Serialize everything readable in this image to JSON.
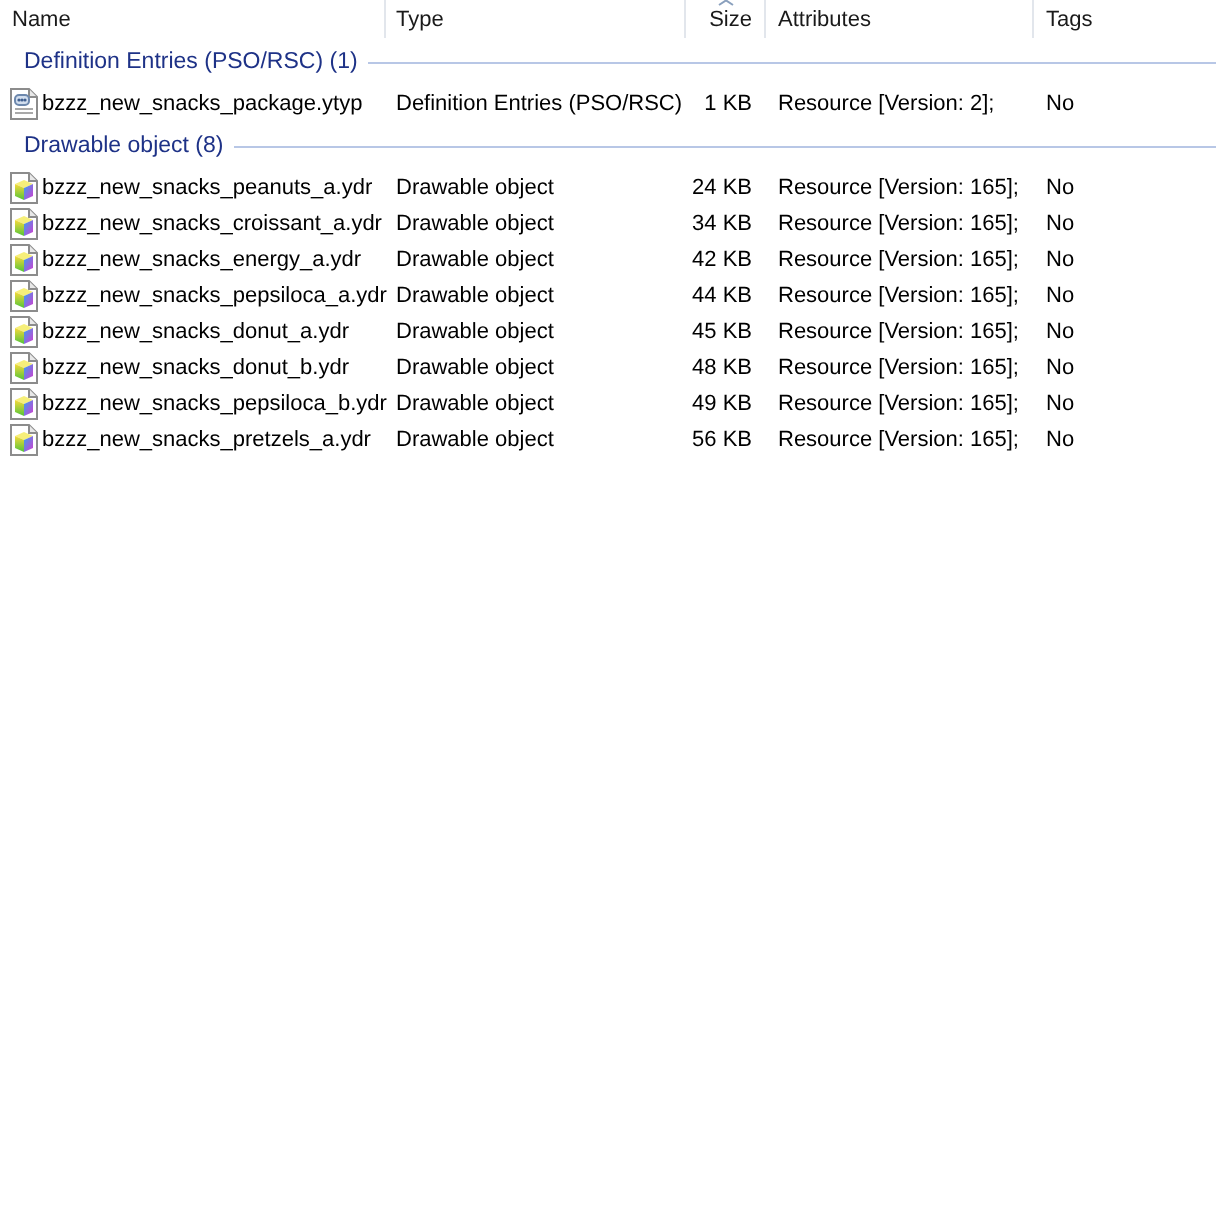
{
  "columns": [
    {
      "label": "Name",
      "sorted": false
    },
    {
      "label": "Type",
      "sorted": false
    },
    {
      "label": "Size",
      "sorted": true
    },
    {
      "label": "Attributes",
      "sorted": false
    },
    {
      "label": "Tags",
      "sorted": false
    }
  ],
  "groups": [
    {
      "title": "Definition Entries (PSO/RSC) (1)",
      "files": [
        {
          "kind": "definition",
          "name": "bzzz_new_snacks_package.ytyp",
          "type": "Definition Entries (PSO/RSC)",
          "size": "1 KB",
          "attributes": "Resource [Version: 2];",
          "tags": "No"
        }
      ]
    },
    {
      "title": "Drawable object (8)",
      "files": [
        {
          "kind": "drawable",
          "name": "bzzz_new_snacks_peanuts_a.ydr",
          "type": "Drawable object",
          "size": "24 KB",
          "attributes": "Resource [Version: 165];",
          "tags": "No"
        },
        {
          "kind": "drawable",
          "name": "bzzz_new_snacks_croissant_a.ydr",
          "type": "Drawable object",
          "size": "34 KB",
          "attributes": "Resource [Version: 165];",
          "tags": "No"
        },
        {
          "kind": "drawable",
          "name": "bzzz_new_snacks_energy_a.ydr",
          "type": "Drawable object",
          "size": "42 KB",
          "attributes": "Resource [Version: 165];",
          "tags": "No"
        },
        {
          "kind": "drawable",
          "name": "bzzz_new_snacks_pepsiloca_a.ydr",
          "type": "Drawable object",
          "size": "44 KB",
          "attributes": "Resource [Version: 165];",
          "tags": "No"
        },
        {
          "kind": "drawable",
          "name": "bzzz_new_snacks_donut_a.ydr",
          "type": "Drawable object",
          "size": "45 KB",
          "attributes": "Resource [Version: 165];",
          "tags": "No"
        },
        {
          "kind": "drawable",
          "name": "bzzz_new_snacks_donut_b.ydr",
          "type": "Drawable object",
          "size": "48 KB",
          "attributes": "Resource [Version: 165];",
          "tags": "No"
        },
        {
          "kind": "drawable",
          "name": "bzzz_new_snacks_pepsiloca_b.ydr",
          "type": "Drawable object",
          "size": "49 KB",
          "attributes": "Resource [Version: 165];",
          "tags": "No"
        },
        {
          "kind": "drawable",
          "name": "bzzz_new_snacks_pretzels_a.ydr",
          "type": "Drawable object",
          "size": "56 KB",
          "attributes": "Resource [Version: 165];",
          "tags": "No"
        }
      ]
    }
  ]
}
